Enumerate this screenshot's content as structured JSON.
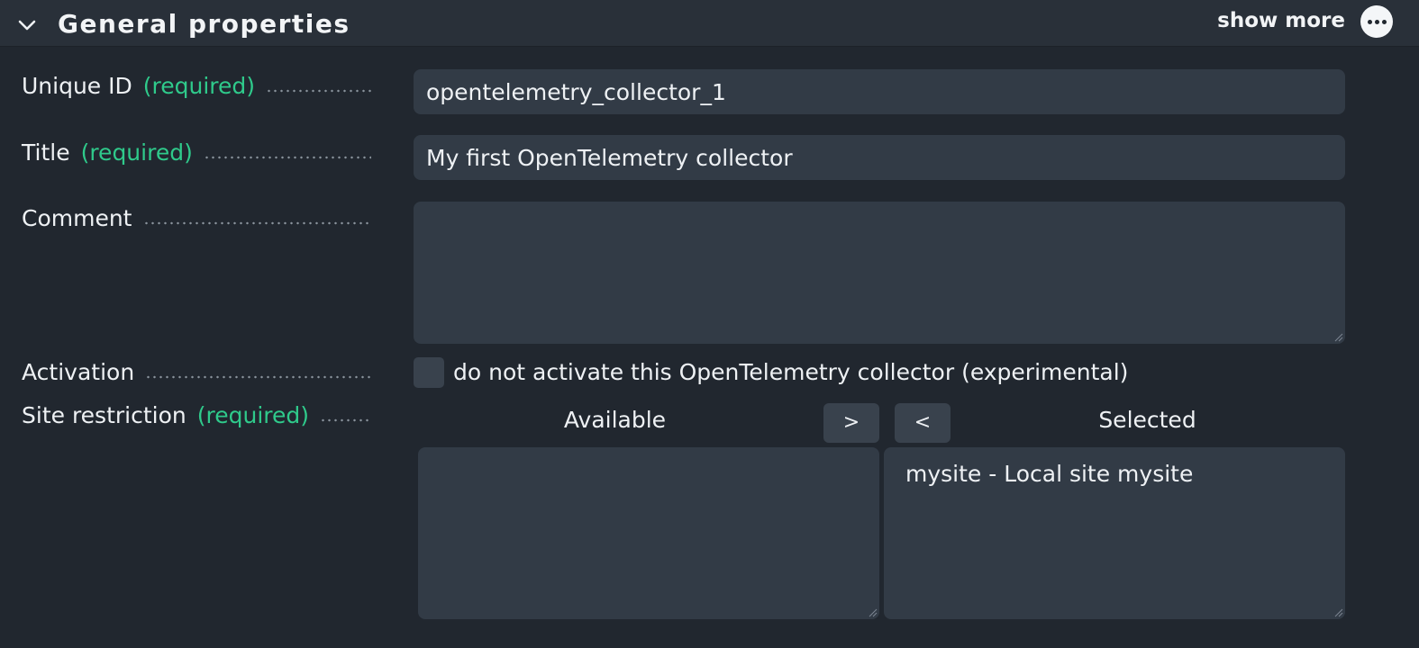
{
  "section": {
    "title": "General properties",
    "show_more_label": "show more"
  },
  "fields": {
    "unique_id": {
      "label": "Unique ID",
      "required": "(required)",
      "value": "opentelemetry_collector_1"
    },
    "title": {
      "label": "Title",
      "required": "(required)",
      "value": "My first OpenTelemetry collector"
    },
    "comment": {
      "label": "Comment",
      "value": ""
    },
    "activation": {
      "label": "Activation",
      "checkbox_label": "do not activate this OpenTelemetry collector (experimental)",
      "checked": false
    },
    "site_restriction": {
      "label": "Site restriction",
      "required": "(required)",
      "available_title": "Available",
      "selected_title": "Selected",
      "add_button": ">",
      "remove_button": "<",
      "available": [],
      "selected": [
        "mysite - Local site mysite"
      ]
    }
  },
  "colors": {
    "background": "#21272f",
    "header": "#293039",
    "field": "#323b46",
    "required": "#2fca8b"
  }
}
